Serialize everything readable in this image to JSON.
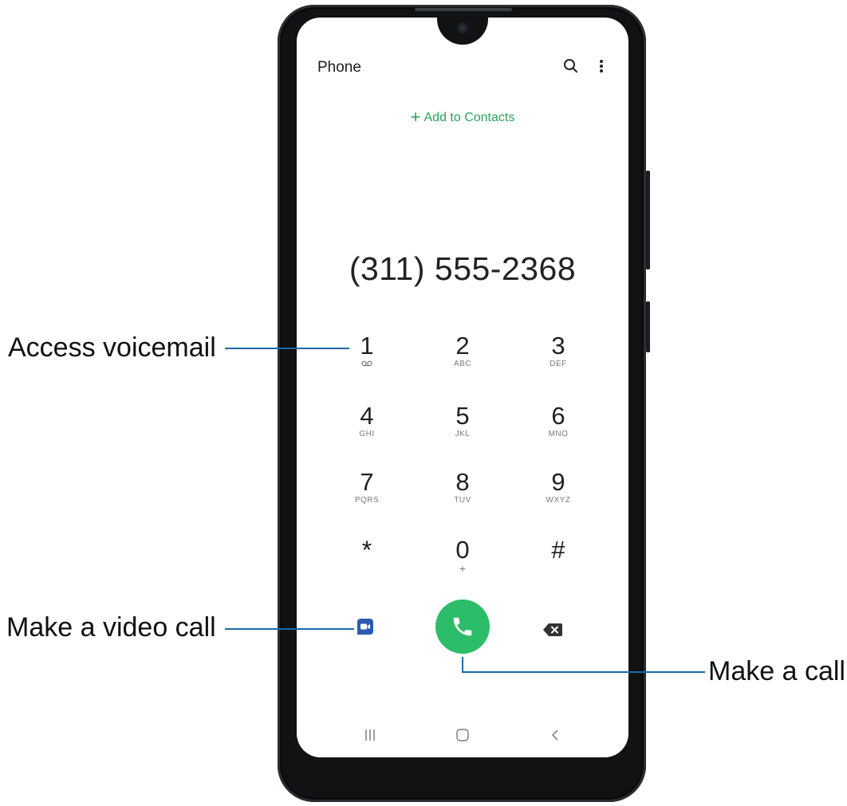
{
  "screen": {
    "app_title": "Phone",
    "header_icons": [
      "search-icon",
      "more-options-icon"
    ],
    "add_to_contacts": {
      "symbol": "+",
      "label": "Add to Contacts"
    },
    "dialed_number": "(311) 555-2368",
    "keypad": [
      {
        "digit": "1",
        "sub": "voicemail-icon"
      },
      {
        "digit": "2",
        "sub": "ABC"
      },
      {
        "digit": "3",
        "sub": "DEF"
      },
      {
        "digit": "4",
        "sub": "GHI"
      },
      {
        "digit": "5",
        "sub": "JKL"
      },
      {
        "digit": "6",
        "sub": "MNO"
      },
      {
        "digit": "7",
        "sub": "PQRS"
      },
      {
        "digit": "8",
        "sub": "TUV"
      },
      {
        "digit": "9",
        "sub": "WXYZ"
      },
      {
        "digit": "*",
        "sub": ""
      },
      {
        "digit": "0",
        "sub": "+"
      },
      {
        "digit": "#",
        "sub": ""
      }
    ],
    "action_icons": [
      "video-call-icon",
      "call-icon",
      "backspace-icon"
    ],
    "nav_icons": [
      "recents-icon",
      "home-icon",
      "back-icon"
    ]
  },
  "callouts": {
    "voicemail": "Access voicemail",
    "video_call": "Make a video call",
    "call": "Make a call"
  },
  "colors": {
    "accent_green": "#29a35a",
    "call_button": "#2dbd6a",
    "video_button": "#2c5bb0",
    "callout_line": "#1a6aa8"
  }
}
